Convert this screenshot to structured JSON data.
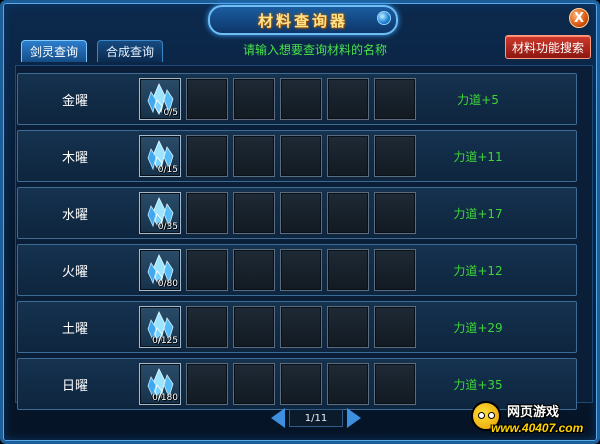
{
  "window": {
    "title": "材料查询器",
    "close_label": "X"
  },
  "tabs": [
    {
      "label": "剑灵查询",
      "active": true
    },
    {
      "label": "合成查询",
      "active": false
    }
  ],
  "hint": "请输入想要查询材料的名称",
  "search_button": "材料功能搜索",
  "rows": [
    {
      "name": "金曜",
      "count": "0/5",
      "bonus": "力道+5"
    },
    {
      "name": "木曜",
      "count": "0/15",
      "bonus": "力道+11"
    },
    {
      "name": "水曜",
      "count": "0/35",
      "bonus": "力道+17"
    },
    {
      "name": "火曜",
      "count": "0/80",
      "bonus": "力道+12"
    },
    {
      "name": "土曜",
      "count": "0/125",
      "bonus": "力道+29"
    },
    {
      "name": "日曜",
      "count": "0/180",
      "bonus": "力道+35"
    }
  ],
  "pager": {
    "label": "1/11"
  },
  "watermark": {
    "line1": "网页游戏",
    "line2": "www.40407.com"
  },
  "colors": {
    "accent": "#3ed43a",
    "hint": "#47e34a",
    "frame": "#1c5e9a"
  },
  "icons": {
    "item": "blue-crystal-icon"
  }
}
